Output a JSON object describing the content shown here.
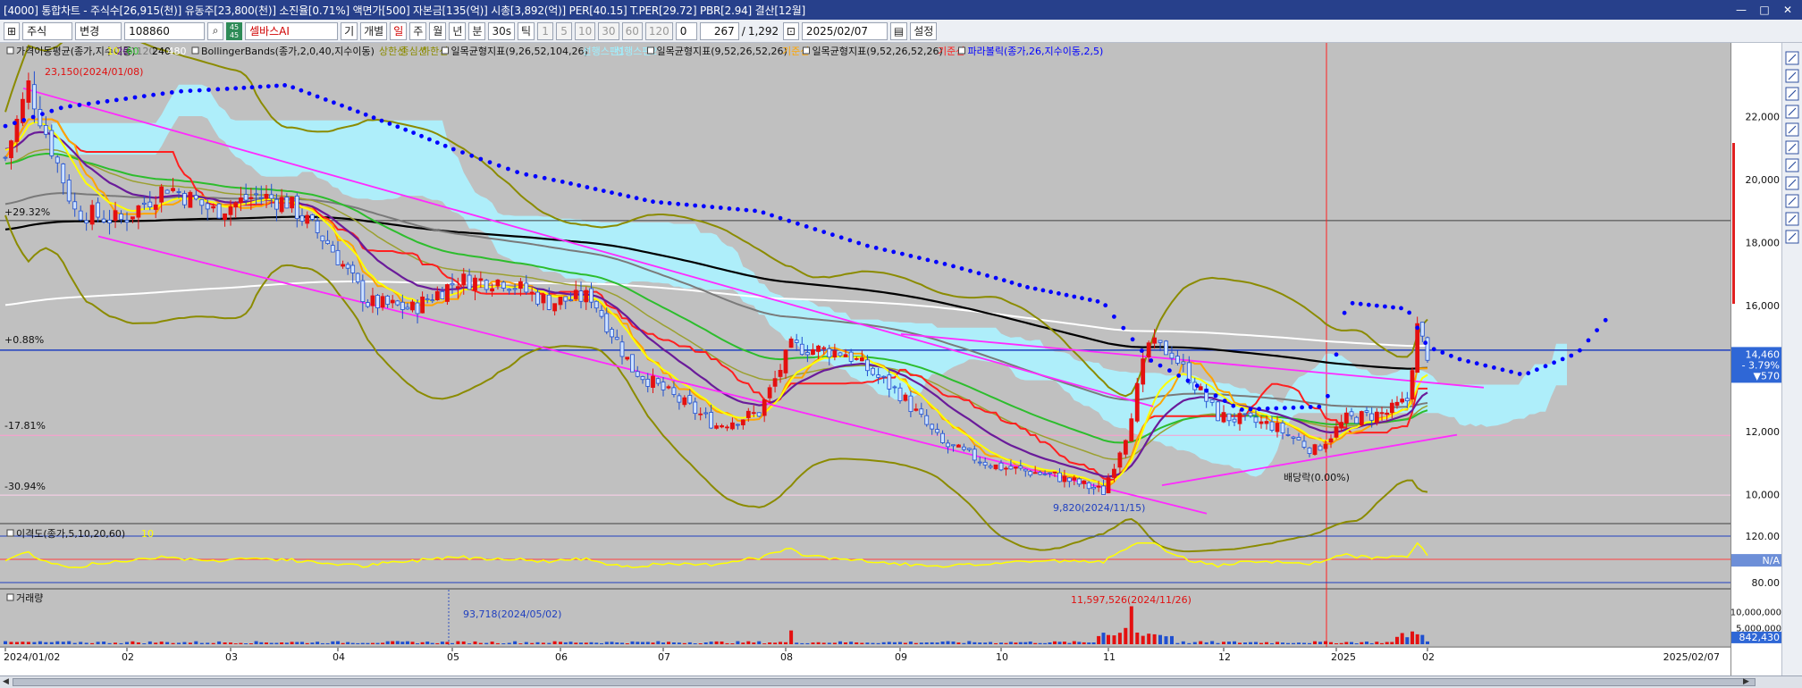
{
  "window": {
    "title": "[4000] 통합차트 - 주식수[26,915(천)] 유동주[23,800(천)] 소진율[0.71%] 액면가[500] 자본금[135(억)] 시총[3,892(억)] PER[40.15] T.PER[29.72] PBR[2.94] 결산[12월]",
    "controls": [
      "▣",
      "⧉",
      "▣",
      "⇱",
      "—",
      "□",
      "✕"
    ]
  },
  "toolbar": {
    "market": "주식",
    "change": "변경",
    "code": "108860",
    "fav_badge": "45 45",
    "stock_name": "셀바스AI",
    "btn_gi": "기",
    "btn_individual": "개별",
    "periods": [
      "일",
      "주",
      "월",
      "년",
      "분",
      "30s",
      "틱",
      "1",
      "5",
      "10",
      "30",
      "60",
      "120"
    ],
    "count": "0",
    "bars": "267",
    "total": "1,292",
    "date": "2025/02/07",
    "settings": "설정"
  },
  "colors": {
    "up": "#e41010",
    "down": "#1f4fd0",
    "ma5": "#ffff00",
    "ma20": "#6a1b9a",
    "ma60": "#2dbd2d",
    "ma120": "#7a7a7a",
    "ma240": "#000000",
    "ma480": "#ffffff",
    "bollinger": "#8b8b00",
    "cloud": "#aeeefa",
    "conversion": "#ffa500",
    "base": "#ff2020",
    "parabolic": "#0000ff",
    "trend": "#ff2aff"
  },
  "legend": {
    "ma": {
      "name": "가격이동평균(종가,지수이동)",
      "periods": [
        "10",
        "20",
        "60",
        "120",
        "240",
        "480"
      ]
    },
    "bb": {
      "name": "BollingerBands(종가,2,0,40,지수이동)",
      "bands": [
        "상한선",
        "중심선",
        "하한선"
      ]
    },
    "ichimoku1": {
      "name": "일목균형지표(9,26,52,104,26)",
      "spans": [
        "선행스팬1",
        "선행스팬2"
      ]
    },
    "ichimoku2": {
      "name": "일목균형지표(9,52,26,52,26)",
      "line": "기준선"
    },
    "ichimoku3": {
      "name": "일목균형지표(9,52,26,52,26)",
      "line": "기준선"
    },
    "sar": {
      "name": "파라볼릭(종가,26,지수이동,2,5)"
    }
  },
  "annotations": {
    "high": "23,150(2024/01/08)",
    "low": "9,820(2024/11/15)",
    "dividend": "배당락(0.00%)",
    "pct_top": "+29.32%",
    "pct_mid": "+0.88%",
    "pct_low1": "-17.81%",
    "pct_low2": "-30.94%",
    "disparity_label": "이격도(종가,5,10,20,60)",
    "disparity_period": "10",
    "volume_label": "거래량",
    "vol_min_note": "93,718(2024/05/02)",
    "vol_max_note": "11,597,526(2024/11/26)"
  },
  "right_axis": {
    "price_ticks": [
      "22,000",
      "20,000",
      "18,000",
      "16,000",
      "12,000",
      "10,000"
    ],
    "ref_levels": [
      "18,700",
      "14,587",
      "11,885",
      "9,986"
    ],
    "current_price": "14,460",
    "change_pct": "- 3.79%",
    "change_abs": "▼570",
    "disp_ticks": [
      "120.00",
      "100.00",
      "80.00"
    ],
    "disp_value": "N/A",
    "vol_ticks": [
      "10,000,000",
      "5,000,000"
    ],
    "vol_current": "842,430"
  },
  "chart_data": {
    "type": "candlestick",
    "ticker": "108860",
    "name": "셀바스AI",
    "period_start": "2024/01/02",
    "period_end": "2025/02/07",
    "x_month_labels": [
      "2024/01/02",
      "02",
      "03",
      "04",
      "05",
      "06",
      "07",
      "08",
      "09",
      "10",
      "11",
      "12",
      "2025",
      "02"
    ],
    "ylim": [
      9000,
      23500
    ],
    "monthly_close_approx": {
      "2024-01": 19500,
      "2024-02": 19200,
      "2024-03": 18600,
      "2024-04": 15900,
      "2024-05": 16700,
      "2024-06": 16100,
      "2024-07": 13000,
      "2024-08": 14700,
      "2024-09": 13200,
      "2024-10": 11000,
      "2024-11": 13400,
      "2024-12": 12500,
      "2025-01": 12900,
      "2025-02": 14460
    },
    "high": {
      "date": "2024/01/08",
      "price": 23150
    },
    "low": {
      "date": "2024/11/15",
      "price": 9820
    },
    "current_price": 14460,
    "disparity_ylim": [
      80,
      120
    ],
    "volume_max": {
      "date": "2024/11/26",
      "value": 11597526
    },
    "volume_min": {
      "date": "2024/05/02",
      "value": 93718
    },
    "volume_ylim": [
      0,
      12000000
    ],
    "volume_current": 842430
  }
}
